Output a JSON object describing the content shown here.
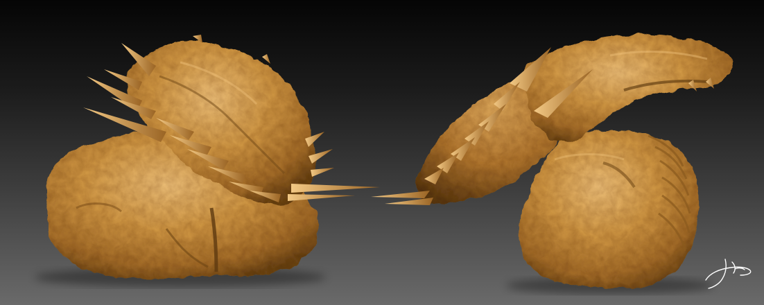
{
  "image": {
    "subject": "sculpted-creature-render",
    "colors": {
      "background_top": "#050505",
      "background_bottom": "#6a6a6a",
      "sculpt_base": "#c8903a",
      "sculpt_highlight": "#f0c27a",
      "sculpt_shadow": "#6e4614"
    },
    "views": [
      {
        "name": "front-view"
      },
      {
        "name": "side-view"
      }
    ],
    "signature": {
      "icon": "signature-icon",
      "color": "#ffffff"
    }
  }
}
